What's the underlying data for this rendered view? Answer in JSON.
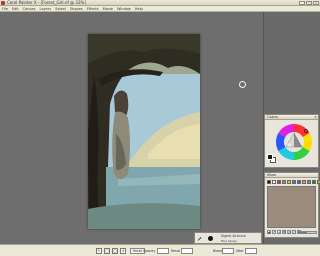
{
  "window": {
    "title": "Corel Painter X - [Forest_Girl.rif @ 33%]",
    "controls": [
      "_",
      "□",
      "×"
    ]
  },
  "menu": [
    "File",
    "Edit",
    "Canvas",
    "Layers",
    "Select",
    "Shapes",
    "Effects",
    "Movie",
    "Window",
    "Help"
  ],
  "panels": {
    "colors": {
      "title": "Colors",
      "close": "×"
    },
    "mixer": {
      "title": "Mixer",
      "swatches": [
        "#111111",
        "#ffffff",
        "#c0392b",
        "#e67e22",
        "#f1c40f",
        "#2e86c1",
        "#884ea0",
        "#e59866",
        "#7f8c8d",
        "#1e8449",
        "#d4ac0d"
      ],
      "color": "#9b8b7c",
      "tools": [
        "▲",
        "↗",
        "+",
        "✥",
        "◎",
        "○",
        "●"
      ],
      "brush_size_fraction": 0.5
    }
  },
  "toolbar": {
    "items": [
      "✎",
      "▢",
      "◯",
      "↺"
    ],
    "reset_label": "Reset",
    "opacity_label": "Opacity",
    "resat_label": "Resat",
    "bleed_label": "Bleed",
    "jitter_label": "Jitter"
  },
  "brush": {
    "name": "Digital Airbrush",
    "variant": "Fine Spray"
  },
  "canvas": {
    "colors": {
      "sky": "#a8c9d8",
      "foliage": "#2f2c22",
      "water": "#7fa7ad",
      "hill": "#d8d2a8"
    }
  }
}
